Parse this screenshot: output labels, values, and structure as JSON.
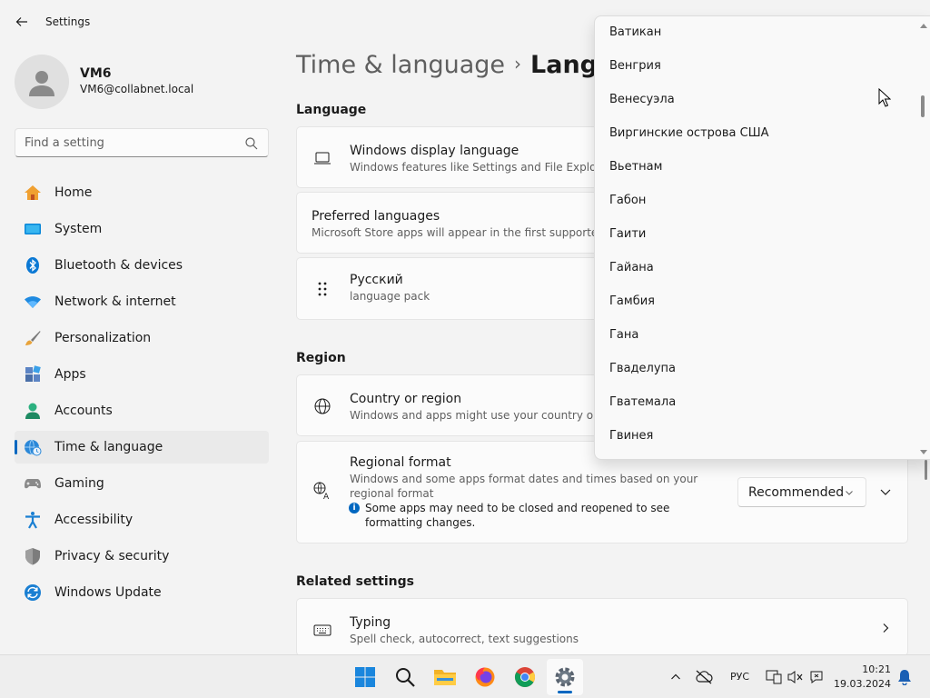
{
  "window": {
    "title": "Settings"
  },
  "profile": {
    "name": "VM6",
    "email": "VM6@collabnet.local"
  },
  "search": {
    "placeholder": "Find a setting"
  },
  "sidebar": {
    "items": [
      {
        "label": "Home",
        "icon": "home-icon"
      },
      {
        "label": "System",
        "icon": "system-icon"
      },
      {
        "label": "Bluetooth & devices",
        "icon": "bluetooth-icon"
      },
      {
        "label": "Network & internet",
        "icon": "wifi-icon"
      },
      {
        "label": "Personalization",
        "icon": "brush-icon"
      },
      {
        "label": "Apps",
        "icon": "apps-icon"
      },
      {
        "label": "Accounts",
        "icon": "accounts-icon"
      },
      {
        "label": "Time & language",
        "icon": "globe-clock-icon",
        "active": true
      },
      {
        "label": "Gaming",
        "icon": "gamepad-icon"
      },
      {
        "label": "Accessibility",
        "icon": "accessibility-icon"
      },
      {
        "label": "Privacy & security",
        "icon": "shield-icon"
      },
      {
        "label": "Windows Update",
        "icon": "update-icon"
      }
    ]
  },
  "breadcrumb": {
    "parent": "Time & language",
    "separator": "›",
    "current": "Langu"
  },
  "language_section": {
    "title": "Language",
    "display_language": {
      "title": "Windows display language",
      "subtitle": "Windows features like Settings and File Explorer wil"
    },
    "preferred": {
      "title": "Preferred languages",
      "subtitle": "Microsoft Store apps will appear in the first supported lang"
    },
    "russian": {
      "title": "Русский",
      "subtitle": "language pack"
    }
  },
  "region_section": {
    "title": "Region",
    "country": {
      "title": "Country or region",
      "subtitle": "Windows and apps might use your country or regio"
    },
    "format": {
      "title": "Regional format",
      "subtitle": "Windows and some apps format dates and times based on your regional format",
      "info": "Some apps may need to be closed and reopened to see formatting changes.",
      "dropdown_value": "Recommended"
    }
  },
  "related_section": {
    "title": "Related settings",
    "typing": {
      "title": "Typing",
      "subtitle": "Spell check, autocorrect, text suggestions"
    }
  },
  "country_popup": {
    "items": [
      "Ватикан",
      "Венгрия",
      "Венесуэла",
      "Виргинские острова США",
      "Вьетнам",
      "Габон",
      "Гаити",
      "Гайана",
      "Гамбия",
      "Гана",
      "Гваделупа",
      "Гватемала",
      "Гвинея"
    ]
  },
  "taskbar": {
    "language": "РУС",
    "time": "10:21",
    "date": "19.03.2024"
  },
  "colors": {
    "accent": "#0067c0",
    "background": "#f3f3f3",
    "card": "#fbfbfb"
  }
}
